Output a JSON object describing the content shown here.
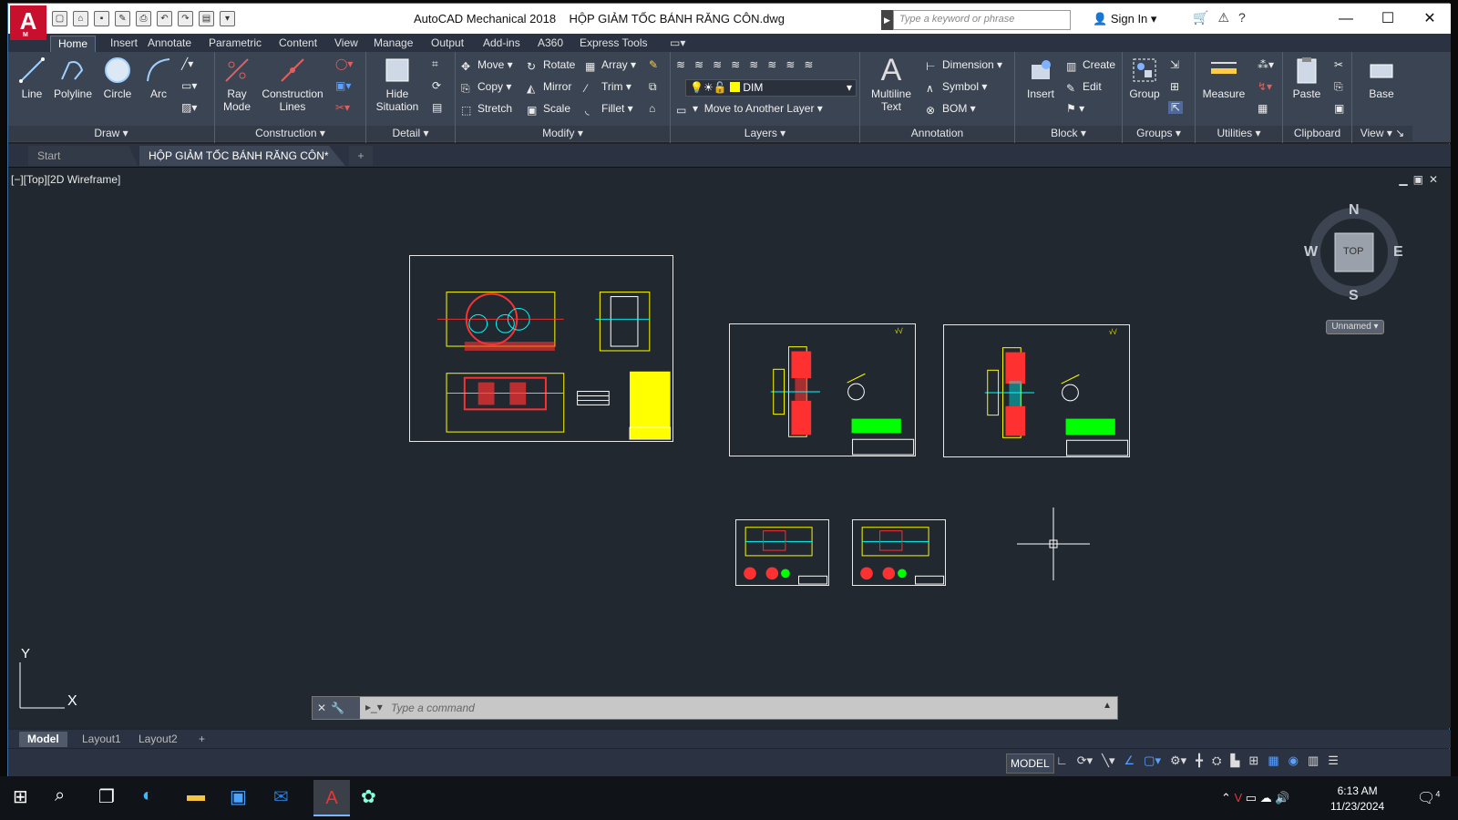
{
  "window": {
    "app_title": "AutoCAD Mechanical 2018",
    "file_title": "HỘP GIẢM TỐC BÁNH RĂNG CÔN.dwg",
    "search_placeholder": "Type a keyword or phrase",
    "sign_in": "Sign In",
    "logo_letter": "A",
    "logo_sub": "M"
  },
  "menu_tabs": [
    "Home",
    "Insert",
    "Annotate",
    "Parametric",
    "Content",
    "View",
    "Manage",
    "Output",
    "Add-ins",
    "A360",
    "Express Tools"
  ],
  "ribbon": {
    "draw": {
      "title": "Draw",
      "line": "Line",
      "polyline": "Polyline",
      "circle": "Circle",
      "arc": "Arc"
    },
    "construction": {
      "title": "Construction",
      "ray_mode": "Ray Mode",
      "construction_lines": "Construction Lines"
    },
    "detail": {
      "title": "Detail",
      "hide_situation": "Hide Situation"
    },
    "modify": {
      "title": "Modify",
      "move": "Move",
      "rotate": "Rotate",
      "array": "Array",
      "copy": "Copy",
      "mirror": "Mirror",
      "trim": "Trim",
      "stretch": "Stretch",
      "scale": "Scale",
      "fillet": "Fillet"
    },
    "layers": {
      "title": "Layers",
      "current_layer": "DIM",
      "move_layer": "Move to Another Layer"
    },
    "annotation": {
      "title": "Annotation",
      "multiline_text": "Multiline Text",
      "dimension": "Dimension",
      "symbol": "Symbol",
      "bom": "BOM"
    },
    "block": {
      "title": "Block",
      "insert": "Insert",
      "create": "Create",
      "edit": "Edit"
    },
    "groups": {
      "title": "Groups",
      "group": "Group"
    },
    "utilities": {
      "title": "Utilities",
      "measure": "Measure"
    },
    "clipboard": {
      "title": "Clipboard",
      "paste": "Paste"
    },
    "view": {
      "title": "View",
      "base": "Base"
    }
  },
  "doc_tabs": {
    "start": "Start",
    "active": "HỘP GIẢM TỐC BÁNH RĂNG CÔN*"
  },
  "viewport": {
    "label": "[−][Top][2D Wireframe]",
    "viewcube": {
      "n": "N",
      "s": "S",
      "e": "E",
      "w": "W",
      "face": "TOP"
    },
    "ucs_name": "Unnamed",
    "axis_x": "X",
    "axis_y": "Y"
  },
  "command": {
    "placeholder": "Type a command"
  },
  "layout_tabs": [
    "Model",
    "Layout1",
    "Layout2"
  ],
  "status": {
    "model": "MODEL"
  },
  "taskbar": {
    "time": "6:13 AM",
    "date": "11/23/2024",
    "notifications": "4"
  }
}
